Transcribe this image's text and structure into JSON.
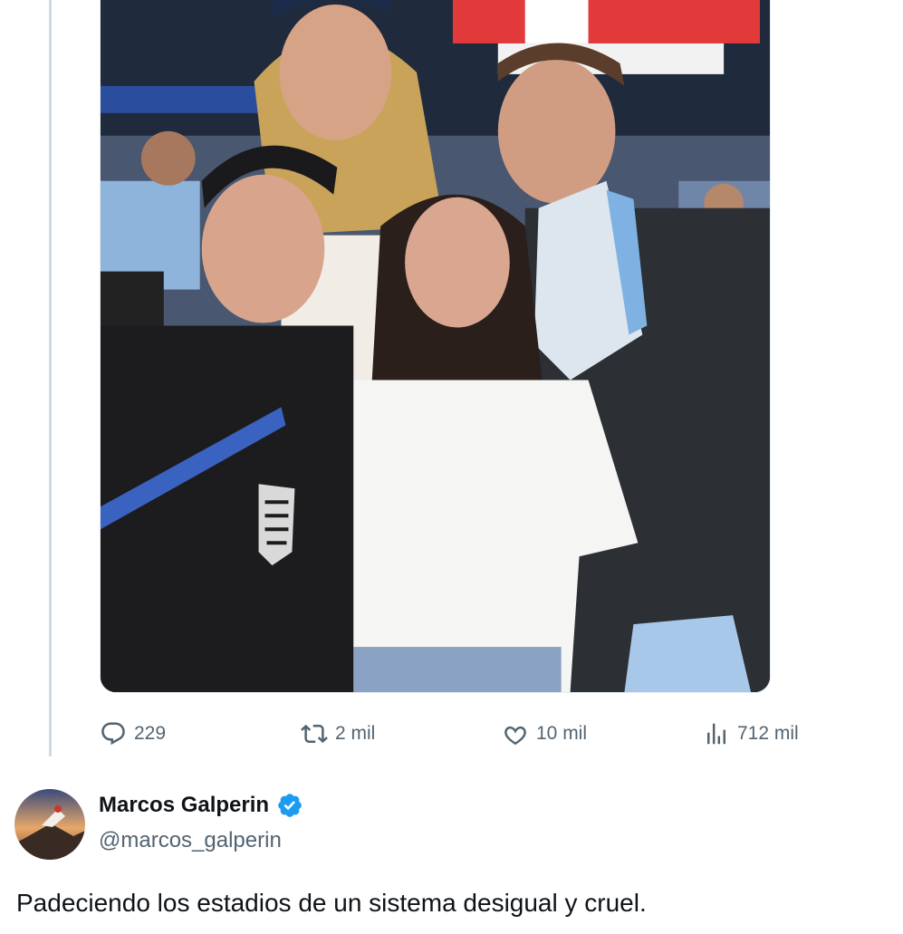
{
  "metrics": {
    "replies": "229",
    "reposts": "2 mil",
    "likes": "10 mil",
    "views": "712 mil"
  },
  "author": {
    "name": "Marcos Galperin",
    "handle": "@marcos_galperin"
  },
  "tweet": {
    "text": "Padeciendo los estadios de un sistema desigual y cruel."
  },
  "colors": {
    "text_primary": "#0f1419",
    "text_secondary": "#536471",
    "verified": "#1d9bf0",
    "thread_line": "#cfd9de"
  },
  "icons": {
    "reply": "reply-icon",
    "repost": "repost-icon",
    "like": "heart-icon",
    "views": "views-icon",
    "verified": "verified-badge-icon"
  }
}
